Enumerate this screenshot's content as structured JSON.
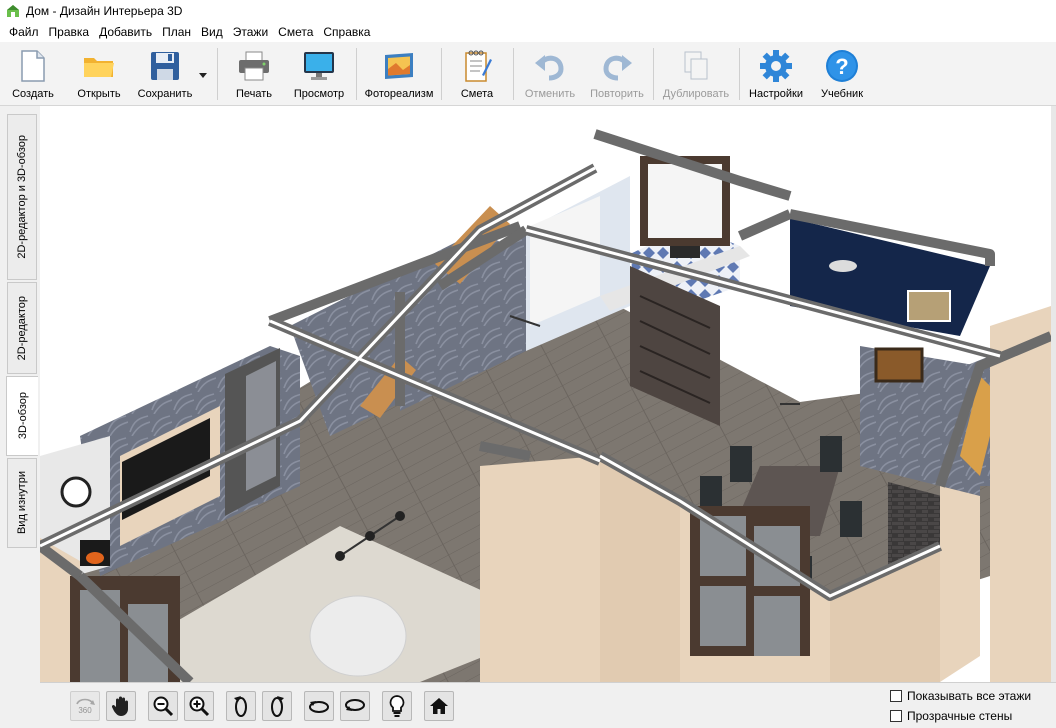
{
  "window": {
    "title": "Дом - Дизайн Интерьера 3D"
  },
  "menu": [
    "Файл",
    "Правка",
    "Добавить",
    "План",
    "Вид",
    "Этажи",
    "Смета",
    "Справка"
  ],
  "toolbar": {
    "create": "Создать",
    "open": "Открыть",
    "save": "Сохранить",
    "print": "Печать",
    "preview": "Просмотр",
    "photoreal": "Фотореализм",
    "estimate": "Смета",
    "undo": "Отменить",
    "redo": "Повторить",
    "duplicate": "Дублировать",
    "settings": "Настройки",
    "tutorial": "Учебник"
  },
  "side_tabs": [
    "2D-редактор и 3D-обзор",
    "2D-редактор",
    "3D-обзор",
    "Вид изнутри"
  ],
  "active_side_tab": "3D-обзор",
  "view_controls": {
    "rotate_360": "360",
    "show_all_floors": "Показывать все этажи",
    "transparent_walls": "Прозрачные стены"
  },
  "colors": {
    "wall_top": "#6b6b6b",
    "wall_outer": "#e8d4bc",
    "wallpaper": "#6e7483",
    "floor": "#7d7770",
    "navy_wall": "#14264a",
    "accent_blue": "#1e7fd6"
  }
}
